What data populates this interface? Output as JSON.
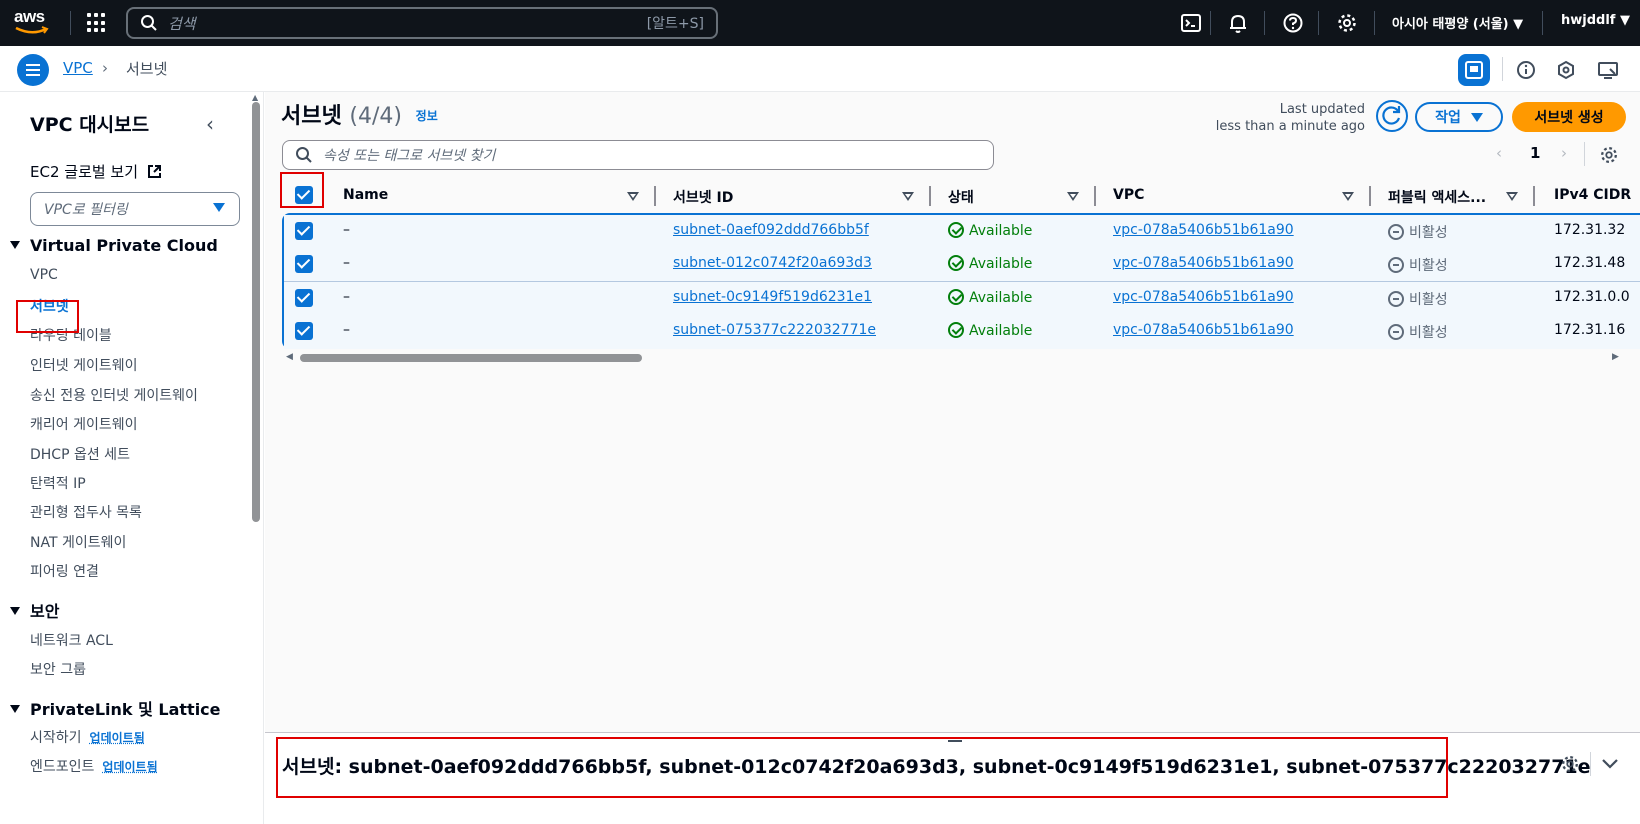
{
  "topnav": {
    "logo_text": "aws",
    "search_placeholder": "검색",
    "search_shortcut": "[알트+S]",
    "region": "아시아 태평양 (서울)",
    "user": "hwjddlf"
  },
  "breadcrumb": {
    "items": [
      "VPC",
      "서브넷"
    ]
  },
  "sidebar": {
    "title": "VPC 대시보드",
    "ec2_link": "EC2 글로벌 보기",
    "filter_placeholder": "VPC로 필터링",
    "sections": [
      {
        "label": "Virtual Private Cloud",
        "items": [
          "VPC",
          "서브넷",
          "라우팅 테이블",
          "인터넷 게이트웨이",
          "송신 전용 인터넷 게이트웨이",
          "캐리어 게이트웨이",
          "DHCP 옵션 세트",
          "탄력적 IP",
          "관리형 접두사 목록",
          "NAT 게이트웨이",
          "피어링 연결"
        ]
      },
      {
        "label": "보안",
        "items": [
          "네트워크 ACL",
          "보안 그룹"
        ]
      },
      {
        "label": "PrivateLink 및 Lattice",
        "items": [
          "시작하기",
          "엔드포인트"
        ],
        "badge": "업데이트됨"
      }
    ]
  },
  "main": {
    "title": "서브넷",
    "count": "(4/4)",
    "info": "정보",
    "last_updated_label": "Last updated",
    "last_updated_value": "less than a minute ago",
    "action_button": "작업",
    "create_button": "서브넷 생성",
    "filter_placeholder": "속성 또는 태그로 서브넷 찾기",
    "page_number": "1",
    "columns": [
      "Name",
      "서브넷 ID",
      "상태",
      "VPC",
      "퍼블릭 액세스...",
      "IPv4 CIDR"
    ],
    "rows": [
      {
        "name": "–",
        "subnet_id": "subnet-0aef092ddd766bb5f",
        "state": "Available",
        "vpc": "vpc-078a5406b51b61a90",
        "public_access": "비활성",
        "cidr": "172.31.32"
      },
      {
        "name": "–",
        "subnet_id": "subnet-012c0742f20a693d3",
        "state": "Available",
        "vpc": "vpc-078a5406b51b61a90",
        "public_access": "비활성",
        "cidr": "172.31.48"
      },
      {
        "name": "–",
        "subnet_id": "subnet-0c9149f519d6231e1",
        "state": "Available",
        "vpc": "vpc-078a5406b51b61a90",
        "public_access": "비활성",
        "cidr": "172.31.0.0"
      },
      {
        "name": "–",
        "subnet_id": "subnet-075377c222032771e",
        "state": "Available",
        "vpc": "vpc-078a5406b51b61a90",
        "public_access": "비활성",
        "cidr": "172.31.16"
      }
    ]
  },
  "split_panel": {
    "title": "서브넷: subnet-0aef092ddd766bb5f, subnet-012c0742f20a693d3, subnet-0c9149f519d6231e1, subnet-075377c222032771e"
  },
  "colors": {
    "accent": "#0972d3",
    "create_button": "#ff9900",
    "available": "#037f0c",
    "highlight_box": "#e00000",
    "topnav_bg": "#0f141a"
  }
}
